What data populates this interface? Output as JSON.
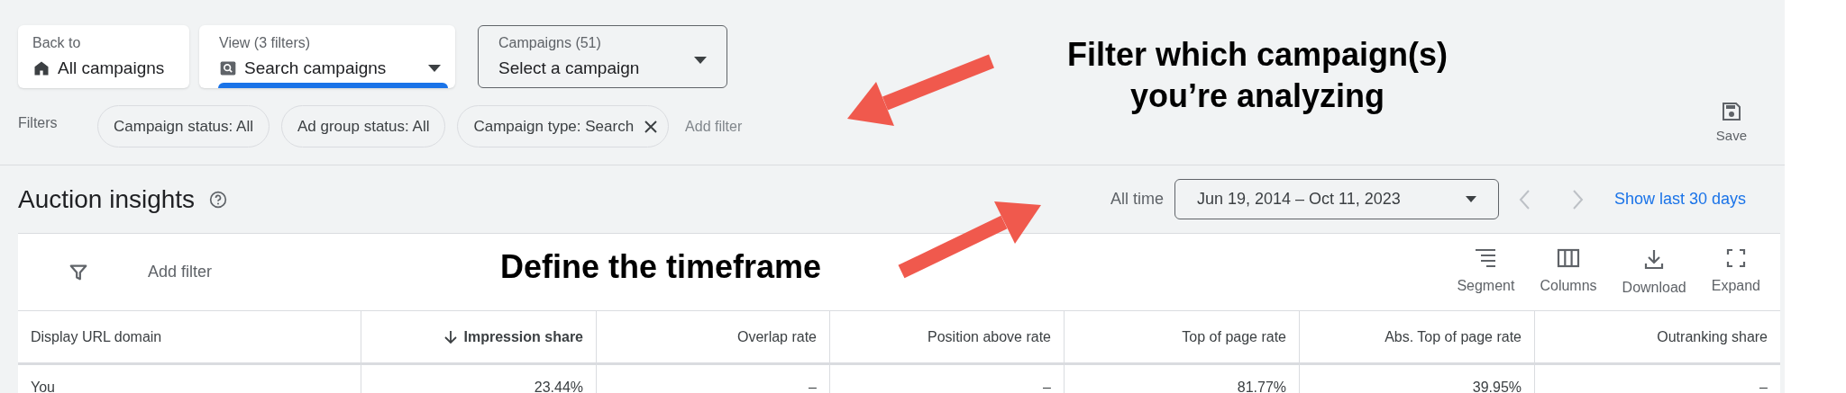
{
  "back_card": {
    "label": "Back to",
    "title": "All campaigns"
  },
  "view_card": {
    "label": "View (3 filters)",
    "value": "Search campaigns"
  },
  "campaign_select": {
    "label": "Campaigns (51)",
    "value": "Select a campaign"
  },
  "filters": {
    "label": "Filters",
    "chips": [
      {
        "text": "Campaign status: All",
        "removable": false
      },
      {
        "text": "Ad group status: All",
        "removable": false
      },
      {
        "text": "Campaign type: Search",
        "removable": true
      }
    ],
    "add_filter": "Add filter"
  },
  "save": {
    "label": "Save"
  },
  "section": {
    "title": "Auction insights"
  },
  "date": {
    "preset": "All time",
    "range": "Jun 19, 2014 – Oct 11, 2023",
    "show_last": "Show last 30 days"
  },
  "toolbar": {
    "add_filter": "Add filter",
    "actions": [
      {
        "label": "Segment",
        "kind": "segment"
      },
      {
        "label": "Columns",
        "kind": "columns"
      },
      {
        "label": "Download",
        "kind": "download"
      },
      {
        "label": "Expand",
        "kind": "expand"
      }
    ]
  },
  "table": {
    "columns": [
      {
        "label": "Display URL domain",
        "sorted": false
      },
      {
        "label": "Impression share",
        "sorted": true
      },
      {
        "label": "Overlap rate",
        "sorted": false
      },
      {
        "label": "Position above rate",
        "sorted": false
      },
      {
        "label": "Top of page rate",
        "sorted": false
      },
      {
        "label": "Abs. Top of page rate",
        "sorted": false
      },
      {
        "label": "Outranking share",
        "sorted": false
      }
    ],
    "rows": [
      {
        "cells": [
          "You",
          "23.44%",
          "–",
          "–",
          "81.77%",
          "39.95%",
          "–"
        ]
      }
    ]
  },
  "annotations": [
    "Filter which campaign(s) you’re analyzing",
    "Define the timeframe"
  ]
}
